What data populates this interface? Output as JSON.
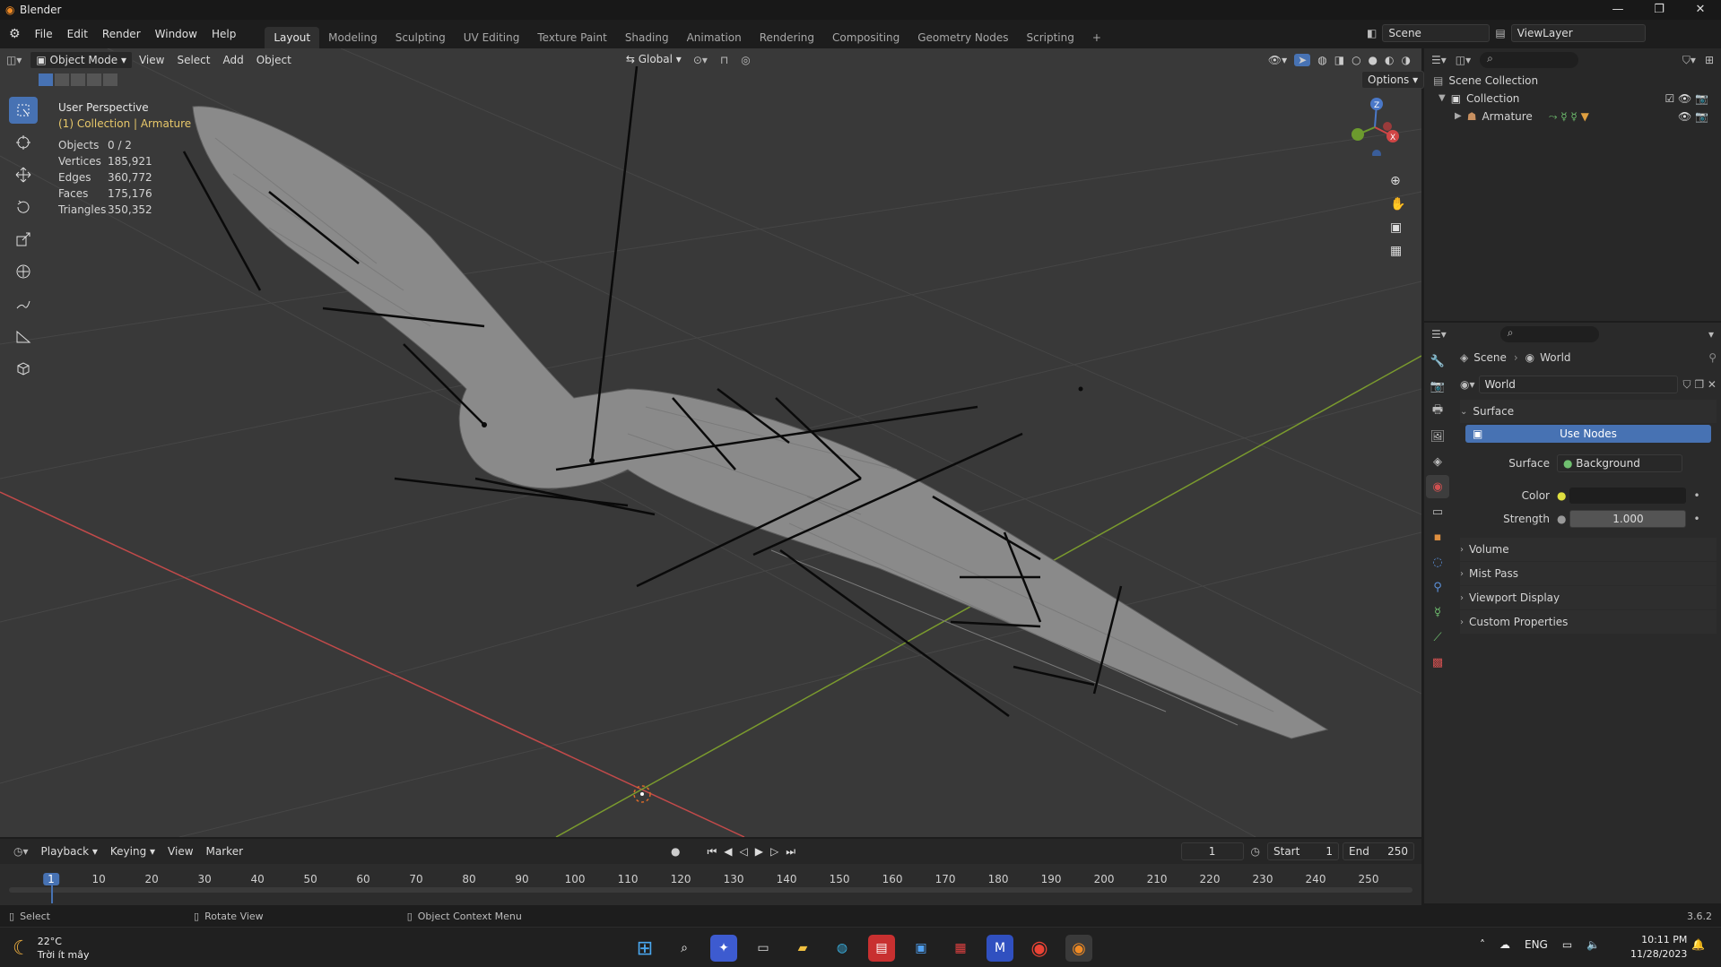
{
  "titlebar": {
    "title": "Blender"
  },
  "menu": {
    "items": [
      "File",
      "Edit",
      "Render",
      "Window",
      "Help"
    ]
  },
  "workspaces": [
    "Layout",
    "Modeling",
    "Sculpting",
    "UV Editing",
    "Texture Paint",
    "Shading",
    "Animation",
    "Rendering",
    "Compositing",
    "Geometry Nodes",
    "Scripting"
  ],
  "topright": {
    "scene": "Scene",
    "view_layer": "ViewLayer"
  },
  "viewport_header": {
    "mode": "Object Mode",
    "menus": [
      "View",
      "Select",
      "Add",
      "Object"
    ],
    "orientation": "Global",
    "options": "Options"
  },
  "viewport_info": {
    "perspective": "User Perspective",
    "context": "(1) Collection | Armature",
    "stats": [
      {
        "label": "Objects",
        "value": "0 / 2"
      },
      {
        "label": "Vertices",
        "value": "185,921"
      },
      {
        "label": "Edges",
        "value": "360,772"
      },
      {
        "label": "Faces",
        "value": "175,176"
      },
      {
        "label": "Triangles",
        "value": "350,352"
      }
    ]
  },
  "outliner": {
    "root": "Scene Collection",
    "collection": "Collection",
    "armature": "Armature"
  },
  "properties": {
    "breadcrumb_scene": "Scene",
    "breadcrumb_world": "World",
    "world_name": "World",
    "surface_panel": "Surface",
    "use_nodes": "Use Nodes",
    "surface_label": "Surface",
    "surface_value": "Background",
    "color_label": "Color",
    "strength_label": "Strength",
    "strength_value": "1.000",
    "panels": [
      "Volume",
      "Mist Pass",
      "Viewport Display",
      "Custom Properties"
    ]
  },
  "timeline": {
    "menus": [
      "Playback",
      "Keying",
      "View",
      "Marker"
    ],
    "current_frame": "1",
    "start_label": "Start",
    "start_value": "1",
    "end_label": "End",
    "end_value": "250",
    "ticks": [
      "1",
      "10",
      "20",
      "30",
      "40",
      "50",
      "60",
      "70",
      "80",
      "90",
      "100",
      "110",
      "120",
      "130",
      "140",
      "150",
      "160",
      "170",
      "180",
      "190",
      "200",
      "210",
      "220",
      "230",
      "240",
      "250"
    ]
  },
  "statusbar": {
    "select": "Select",
    "rotate": "Rotate View",
    "context_menu": "Object Context Menu",
    "version": "3.6.2"
  },
  "taskbar": {
    "temperature": "22°C",
    "weather": "Trời ít mây",
    "language": "ENG",
    "time": "10:11 PM",
    "date": "11/28/2023"
  },
  "colors": {
    "accent": "#4772b3",
    "viewport_bg": "#393939",
    "x_axis": "#c24a4a",
    "y_axis": "#7a9a2e"
  }
}
